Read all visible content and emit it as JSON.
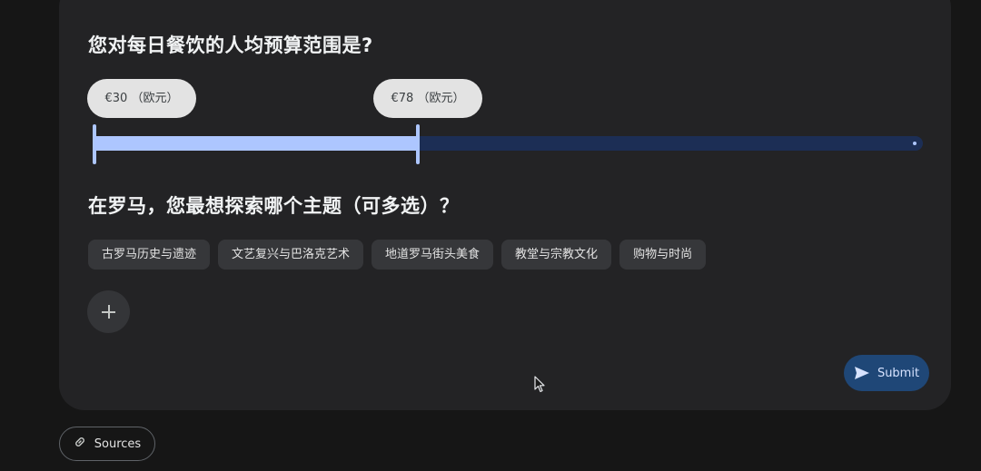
{
  "budget_question": {
    "title": "您对每日餐饮的人均预算范围是?",
    "min_label": "€30 （欧元）",
    "max_label": "€78 （欧元）",
    "range_fill_fraction": [
      0,
      0.39
    ]
  },
  "topics_question": {
    "title": "在罗马，您最想探索哪个主题（可多选）？",
    "chips": [
      "古罗马历史与遗迹",
      "文艺复兴与巴洛克艺术",
      "地道罗马街头美食",
      "教堂与宗教文化",
      "购物与时尚"
    ]
  },
  "actions": {
    "submit_label": "Submit",
    "add_icon": "plus-icon",
    "submit_icon": "send-icon"
  },
  "footer": {
    "sources_label": "Sources",
    "sources_icon": "link-icon"
  },
  "colors": {
    "accent": "#adc6ff",
    "track_bg": "#1c2e55",
    "submit_bg": "#1f4777"
  }
}
